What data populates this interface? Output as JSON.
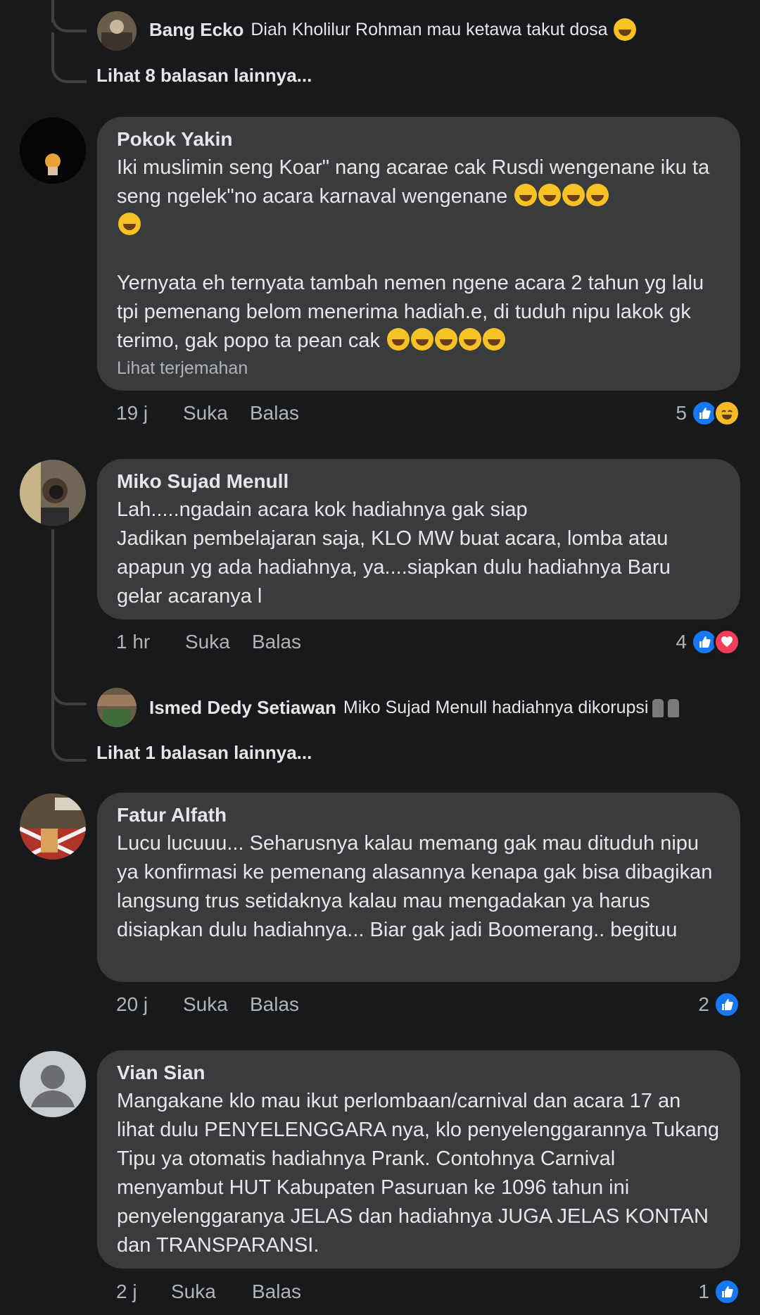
{
  "top_reply": {
    "author": "Bang Ecko",
    "text": "Diah Kholilur Rohman mau ketawa takut dosa",
    "more_link": "Lihat 8 balasan lainnya..."
  },
  "comments": [
    {
      "author": "Pokok Yakin",
      "text": "Iki muslimin seng Koar\" nang acarae cak Rusdi wengenane iku ta seng ngelek\"no acara karnaval wengenane",
      "text2": "Yernyata eh ternyata tambah nemen ngene acara 2 tahun yg lalu tpi pemenang belom menerima hadiah.e, di tuduh nipu lakok gk terimo, gak popo ta pean cak",
      "translate": "Lihat terjemahan",
      "time": "19 j",
      "like": "Suka",
      "reply": "Balas",
      "reaction_count": "5",
      "reactions": [
        "like-icon",
        "haha-icon"
      ]
    },
    {
      "author": "Miko Sujad Menull",
      "text": "Lah.....ngadain acara kok hadiahnya gak siap\nJadikan pembelajaran saja, KLO MW buat acara, lomba atau apapun yg ada hadiahnya, ya....siapkan dulu hadiahnya Baru gelar acaranya l",
      "time": "1 hr",
      "like": "Suka",
      "reply": "Balas",
      "reaction_count": "4",
      "reactions": [
        "like-icon",
        "heart-icon"
      ],
      "sub_reply": {
        "author": "Ismed Dedy Setiawan",
        "text": "Miko Sujad Menull hadiahnya dikorupsi"
      },
      "more_link": "Lihat 1 balasan lainnya..."
    },
    {
      "author": "Fatur Alfath",
      "text": "Lucu lucuuu... Seharusnya kalau memang gak mau dituduh nipu ya konfirmasi ke pemenang alasannya kenapa gak bisa dibagikan langsung trus setidaknya kalau mau mengadakan ya harus disiapkan dulu hadiahnya... Biar gak jadi Boomerang.. begituu",
      "time": "20 j",
      "like": "Suka",
      "reply": "Balas",
      "reaction_count": "2",
      "reactions": [
        "like-icon"
      ]
    },
    {
      "author": "Vian Sian",
      "text": "Mangakane klo mau ikut perlombaan/carnival dan acara 17 an lihat dulu PENYELENGGARA nya, klo penyelenggarannya Tukang Tipu ya otomatis hadiahnya Prank. Contohnya Carnival menyambut HUT Kabupaten Pasuruan ke 1096 tahun ini penyelenggaranya JELAS dan hadiahnya JUGA JELAS KONTAN dan TRANSPARANSI.",
      "time": "2 j",
      "like": "Suka",
      "reply": "Balas",
      "reaction_count": "1",
      "reactions": [
        "like-icon"
      ]
    }
  ]
}
